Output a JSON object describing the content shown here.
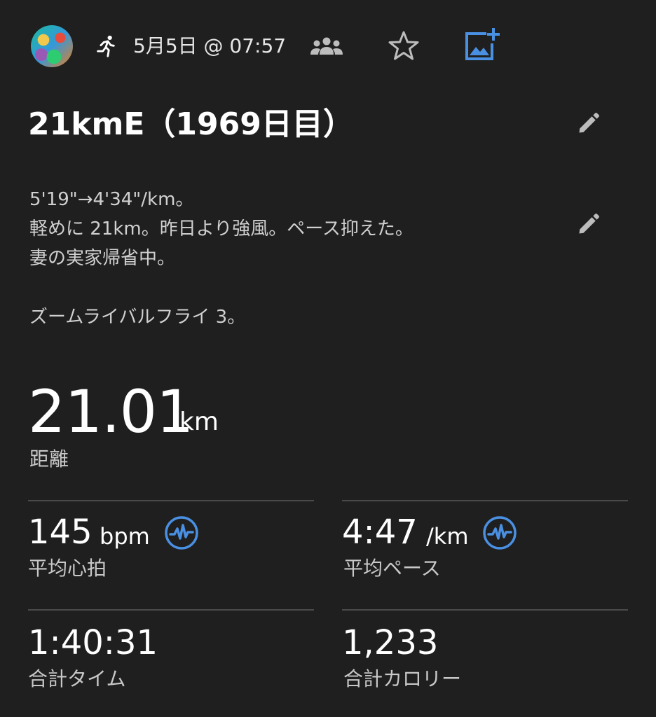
{
  "header": {
    "date_time": "5月5日 @ 07:57",
    "icons": [
      "avatar",
      "running-icon",
      "group-icon",
      "star-icon",
      "add-photo-icon"
    ],
    "accent_color": "#4a90e2"
  },
  "activity": {
    "title": "21kmE（1969日目）",
    "notes": [
      "5'19\"→4'34\"/km。",
      "軽めに 21km。昨日より強風。ペース抑えた。",
      "妻の実家帰省中。",
      "",
      "ズームライバルフライ 3。"
    ]
  },
  "distance": {
    "value": "21.01",
    "unit": "km",
    "label": "距離"
  },
  "stats": {
    "heart_rate": {
      "value": "145",
      "unit": "bpm",
      "label": "平均心拍",
      "icon": "pulse-icon"
    },
    "pace": {
      "value": "4:47",
      "unit": "/km",
      "label": "平均ペース",
      "icon": "pulse-icon"
    },
    "total_time": {
      "value": "1:40:31",
      "label": "合計タイム"
    },
    "calories": {
      "value": "1,233",
      "label": "合計カロリー"
    }
  }
}
